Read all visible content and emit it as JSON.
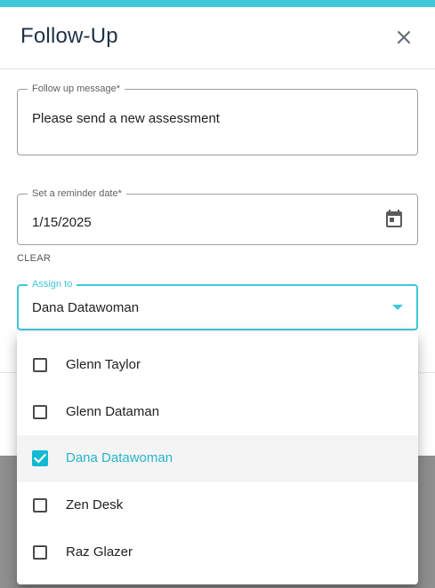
{
  "dialog": {
    "title": "Follow-Up",
    "close_icon": "close-icon"
  },
  "form": {
    "message": {
      "label": "Follow up message*",
      "value": "Please send a new assessment"
    },
    "reminder": {
      "label": "Set a reminder date*",
      "value": "1/15/2025",
      "icon": "calendar-icon",
      "clear_label": "CLEAR"
    },
    "assign": {
      "label": "Assign to",
      "value": "Dana Datawoman",
      "icon": "dropdown-arrow-icon"
    }
  },
  "menu": {
    "options": [
      {
        "label": "Glenn Taylor",
        "checked": false
      },
      {
        "label": "Glenn Dataman",
        "checked": false
      },
      {
        "label": "Dana Datawoman",
        "checked": true
      },
      {
        "label": "Zen Desk",
        "checked": false
      },
      {
        "label": "Raz Glazer",
        "checked": false
      }
    ]
  },
  "colors": {
    "accent": "#40c7d9",
    "checkbox_checked": "#12b9d2",
    "selected_text": "#27b5cc",
    "title_text": "#1f3145"
  }
}
